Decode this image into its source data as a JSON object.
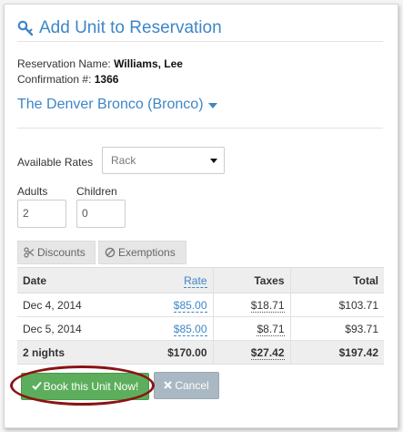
{
  "dialog": {
    "title": "Add Unit to Reservation",
    "title_icon": "key-icon",
    "accent_color": "#3e86c7"
  },
  "reservation": {
    "name_label": "Reservation Name:",
    "name_value": "Williams, Lee",
    "confirmation_label": "Confirmation #:",
    "confirmation_value": "1366"
  },
  "unit": {
    "name": "The Denver Bronco (Bronco)"
  },
  "rates": {
    "label": "Available Rates",
    "selected": "Rack"
  },
  "guests": {
    "adults_label": "Adults",
    "adults_value": "2",
    "children_label": "Children",
    "children_value": "0"
  },
  "actions_top": {
    "discounts_label": "Discounts",
    "exemptions_label": "Exemptions"
  },
  "table": {
    "headers": {
      "date": "Date",
      "rate": "Rate",
      "taxes": "Taxes",
      "total": "Total"
    },
    "rows": [
      {
        "date": "Dec 4, 2014",
        "rate": "$85.00",
        "taxes": "$18.71",
        "total": "$103.71"
      },
      {
        "date": "Dec 5, 2014",
        "rate": "$85.00",
        "taxes": "$8.71",
        "total": "$93.71"
      }
    ],
    "summary": {
      "date": "2 nights",
      "rate": "$170.00",
      "taxes": "$27.42",
      "total": "$197.42"
    }
  },
  "buttons": {
    "book_label": "Book this Unit Now!",
    "book_color": "#5cae5c",
    "cancel_label": "Cancel",
    "cancel_color": "#a9b8c2",
    "highlight_color": "#8a1414"
  }
}
